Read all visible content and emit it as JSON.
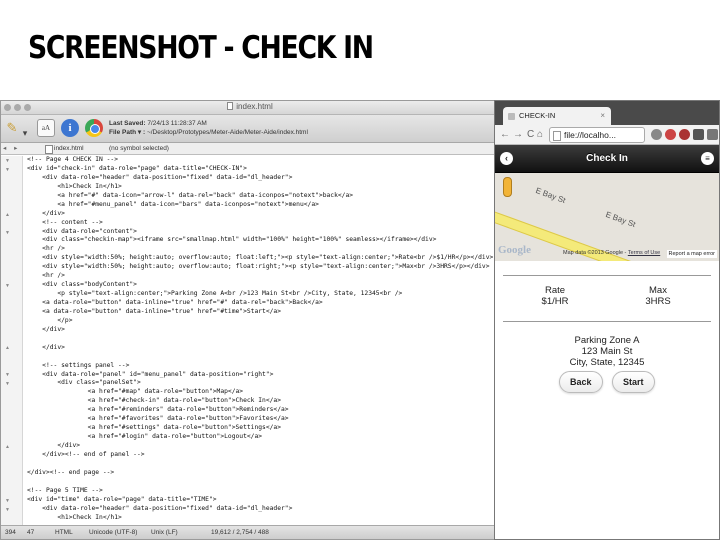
{
  "slide": {
    "title": "SCREENSHOT - CHECK IN"
  },
  "editor": {
    "window_title": "index.html",
    "toolbar": {
      "last_saved_label": "Last Saved:",
      "last_saved_value": "7/24/13 11:28:37 AM",
      "file_path_label": "File Path ▾ :",
      "file_path_value": "~/Desktop/Prototypes/Meter-Aide/Meter-Aide/index.html"
    },
    "pathbar": {
      "nav": "◂ ▸",
      "file": "index.html",
      "symbol": "(no symbol selected)"
    },
    "code_lines": [
      "<!-- Page 4 CHECK IN -->",
      "<div id=\"check-in\" data-role=\"page\" data-title=\"CHECK-IN\">",
      "    <div data-role=\"header\" data-position=\"fixed\" data-id=\"dl_header\">",
      "        <h1>Check In</h1>",
      "        <a href=\"#\" data-icon=\"arrow-l\" data-rel=\"back\" data-iconpos=\"notext\">back</a>",
      "        <a href=\"#menu_panel\" data-icon=\"bars\" data-iconpos=\"notext\">menu</a>",
      "    </div>",
      "    <!-- content -->",
      "    <div data-role=\"content\">",
      "    <div class=\"checkin-map\"><iframe src=\"smallmap.html\" width=\"100%\" height=\"100%\" seamless></iframe></div>",
      "    <hr />",
      "    <div style=\"width:50%; height:auto; overflow:auto; float:left;\"><p style=\"text-align:center;\">Rate<br />$1/HR</p></div>",
      "    <div style=\"width:50%; height:auto; overflow:auto; float:right;\"><p style=\"text-align:center;\">Max<br />3HRS</p></div>",
      "    <hr />",
      "    <div class=\"bodyContent\">",
      "        <p style=\"text-align:center;\">Parking Zone A<br />123 Main St<br />City, State, 12345<br />",
      "    <a data-role=\"button\" data-inline=\"true\" href=\"#\" data-rel=\"back\">Back</a>",
      "    <a data-role=\"button\" data-inline=\"true\" href=\"#time\">Start</a>",
      "        </p>",
      "    </div>",
      "",
      "    </div>",
      "",
      "    <!-- settings panel -->",
      "    <div data-role=\"panel\" id=\"menu_panel\" data-position=\"right\">",
      "        <div class=\"panelSet\">",
      "                <a href=\"#map\" data-role=\"button\">Map</a>",
      "                <a href=\"#check-in\" data-role=\"button\">Check In</a>",
      "                <a href=\"#reminders\" data-role=\"button\">Reminders</a>",
      "                <a href=\"#favorites\" data-role=\"button\">Favorites</a>",
      "                <a href=\"#settings\" data-role=\"button\">Settings</a>",
      "                <a href=\"#login\" data-role=\"button\">Logout</a>",
      "        </div>",
      "    </div><!-- end of panel -->",
      "",
      "</div><!-- end page -->",
      "",
      "<!-- Page 5 TIME -->",
      "<div id=\"time\" data-role=\"page\" data-title=\"TIME\">",
      "    <div data-role=\"header\" data-position=\"fixed\" data-id=\"dl_header\">",
      "        <h1>Check In</h1>"
    ],
    "status": {
      "line": "394",
      "col": "47",
      "language": "HTML",
      "encoding": "Unicode (UTF-8)",
      "line_endings": "Unix (LF)",
      "counts": "19,612 / 2,754 / 488"
    }
  },
  "browser": {
    "tab_title": "CHECK-IN",
    "tab_close": "×",
    "url": "file://localho...",
    "nav": {
      "back": "←",
      "forward": "→",
      "reload": "C",
      "home": "⌂"
    }
  },
  "app": {
    "header_title": "Check In",
    "back_icon": "‹",
    "menu_icon": "≡",
    "map": {
      "street_label_1": "E Bay St",
      "street_label_2": "E Bay St",
      "logo": "Google",
      "attribution": "Map data ©2013 Google",
      "terms": "Terms of Use",
      "report": "Report a map error"
    },
    "rate": {
      "label": "Rate",
      "value": "$1/HR"
    },
    "max": {
      "label": "Max",
      "value": "3HRS"
    },
    "address": {
      "line1": "Parking Zone A",
      "line2": "123 Main St",
      "line3": "City, State, 12345"
    },
    "buttons": {
      "back": "Back",
      "start": "Start"
    }
  },
  "colors": {
    "header_bg": "#111111",
    "road": "#f4ea7a",
    "map_bg": "#e6e3dc"
  }
}
